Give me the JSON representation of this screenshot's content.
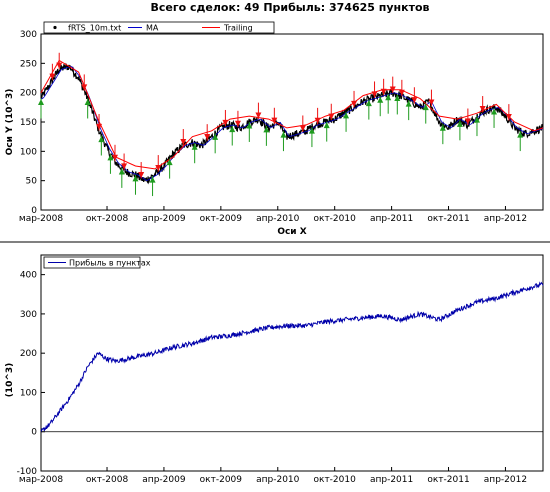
{
  "title": "Всего сделок:  49 Прибыль: 374625 пунктов",
  "top_chart": {
    "xlabel": "Оси X",
    "ylabel": "Оси Y (10^3)",
    "legend": [
      "fRTS_10m.txt",
      "MA",
      "Trailing"
    ]
  },
  "bottom_chart": {
    "ylabel": "(10^3)",
    "legend": [
      "Прибыль в пунктах"
    ]
  },
  "colors": {
    "price": "#000000",
    "ma": "#0000cc",
    "trailing": "#ff0000",
    "buy": "#1e9b1e",
    "sell": "#ee1111",
    "profit": "#0000aa"
  },
  "chart_data": [
    {
      "type": "line",
      "x_ticks": [
        "мар-2008",
        "окт-2008",
        "апр-2009",
        "окт-2009",
        "апр-2010",
        "окт-2010",
        "апр-2011",
        "окт-2011",
        "апр-2012"
      ],
      "x_tick_positions": [
        2008.17,
        2008.75,
        2009.25,
        2009.75,
        2010.25,
        2010.75,
        2011.25,
        2011.75,
        2012.25
      ],
      "xlim": [
        2008.17,
        2012.58
      ],
      "ylim": [
        0,
        300
      ],
      "y_ticks": [
        0,
        50,
        100,
        150,
        200,
        250,
        300
      ],
      "series": [
        {
          "name": "fRTS_10m.txt",
          "x": [
            2008.17,
            2008.25,
            2008.33,
            2008.42,
            2008.5,
            2008.58,
            2008.67,
            2008.75,
            2008.83,
            2008.92,
            2009.0,
            2009.08,
            2009.17,
            2009.25,
            2009.33,
            2009.42,
            2009.5,
            2009.58,
            2009.67,
            2009.75,
            2009.83,
            2009.92,
            2010.0,
            2010.08,
            2010.17,
            2010.25,
            2010.33,
            2010.42,
            2010.5,
            2010.58,
            2010.67,
            2010.75,
            2010.83,
            2010.92,
            2011.0,
            2011.08,
            2011.17,
            2011.25,
            2011.33,
            2011.42,
            2011.5,
            2011.58,
            2011.67,
            2011.75,
            2011.83,
            2011.92,
            2012.0,
            2012.08,
            2012.17,
            2012.25,
            2012.33,
            2012.42,
            2012.5,
            2012.58
          ],
          "y": [
            190,
            215,
            240,
            245,
            225,
            190,
            140,
            105,
            80,
            65,
            60,
            50,
            60,
            75,
            95,
            110,
            115,
            110,
            125,
            140,
            145,
            140,
            150,
            155,
            140,
            150,
            125,
            130,
            135,
            145,
            150,
            155,
            165,
            175,
            185,
            190,
            195,
            200,
            195,
            185,
            175,
            185,
            150,
            140,
            155,
            145,
            160,
            170,
            175,
            160,
            140,
            130,
            135,
            140
          ]
        },
        {
          "name": "Trailing",
          "x": [
            2008.17,
            2008.33,
            2008.5,
            2008.67,
            2008.83,
            2009.0,
            2009.17,
            2009.33,
            2009.5,
            2009.67,
            2009.83,
            2010.0,
            2010.17,
            2010.33,
            2010.5,
            2010.67,
            2010.83,
            2011.0,
            2011.17,
            2011.33,
            2011.5,
            2011.67,
            2011.83,
            2012.0,
            2012.17,
            2012.33,
            2012.5,
            2012.58
          ],
          "y": [
            200,
            255,
            235,
            155,
            90,
            75,
            70,
            90,
            125,
            135,
            155,
            160,
            155,
            140,
            145,
            160,
            170,
            195,
            205,
            205,
            190,
            160,
            155,
            165,
            180,
            150,
            135,
            140
          ]
        }
      ]
    },
    {
      "type": "line",
      "x_ticks": [
        "мар-2008",
        "окт-2008",
        "апр-2009",
        "окт-2009",
        "апр-2010",
        "окт-2010",
        "апр-2011",
        "окт-2011",
        "апр-2012"
      ],
      "x_tick_positions": [
        2008.17,
        2008.75,
        2009.25,
        2009.75,
        2010.25,
        2010.75,
        2011.25,
        2011.75,
        2012.25
      ],
      "xlim": [
        2008.17,
        2012.58
      ],
      "ylim": [
        -100,
        450
      ],
      "y_ticks": [
        -100,
        0,
        100,
        200,
        300,
        400
      ],
      "series": [
        {
          "name": "Прибыль в пунктах",
          "x": [
            2008.17,
            2008.25,
            2008.33,
            2008.42,
            2008.5,
            2008.58,
            2008.67,
            2008.75,
            2008.83,
            2008.92,
            2009.0,
            2009.17,
            2009.33,
            2009.5,
            2009.67,
            2009.83,
            2010.0,
            2010.17,
            2010.33,
            2010.5,
            2010.67,
            2010.83,
            2011.0,
            2011.17,
            2011.33,
            2011.5,
            2011.67,
            2011.83,
            2012.0,
            2012.17,
            2012.33,
            2012.5,
            2012.58
          ],
          "y": [
            0,
            20,
            50,
            85,
            120,
            165,
            200,
            185,
            180,
            185,
            190,
            200,
            215,
            225,
            240,
            245,
            255,
            265,
            270,
            270,
            280,
            285,
            290,
            295,
            285,
            300,
            285,
            310,
            330,
            340,
            355,
            370,
            375
          ]
        }
      ]
    }
  ]
}
